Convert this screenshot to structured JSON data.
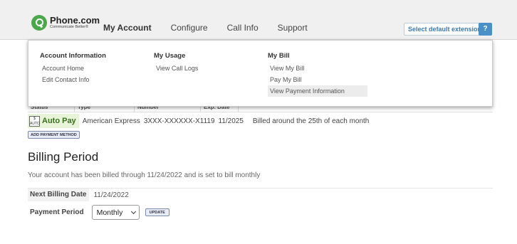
{
  "header": {
    "logo_name": "Phone.com",
    "logo_tagline": "Communicate Better®",
    "nav": [
      "My Account",
      "Configure",
      "Call Info",
      "Support"
    ],
    "extension_label": "Select default extension",
    "help_label": "?"
  },
  "menu": {
    "columns": [
      {
        "title": "Account Information",
        "links": [
          "Account Home",
          "Edit Contact Info"
        ]
      },
      {
        "title": "My Usage",
        "links": [
          "View Call Logs"
        ]
      },
      {
        "title": "My Bill",
        "links": [
          "View My Bill",
          "Pay My Bill",
          "View Payment Information"
        ]
      }
    ]
  },
  "payment_table": {
    "headers": [
      "Status",
      "Type",
      "Number",
      "Exp. Date"
    ],
    "row": {
      "icon_text": "AUTO",
      "status": "Auto Pay",
      "type": "American Express",
      "number": "3XXX-XXXXXX-X1119",
      "exp": "11/2025",
      "note": "Billed around the 25th of each month"
    },
    "add_button": "ADD PAYMENT METHOD"
  },
  "billing": {
    "title": "Billing Period",
    "description": "Your account has been billed through 11/24/2022 and is set to bill monthly",
    "next_label": "Next Billing Date",
    "next_value": "11/24/2022",
    "period_label": "Payment Period",
    "period_value": "Monthly",
    "update_button": "UPDATE"
  }
}
